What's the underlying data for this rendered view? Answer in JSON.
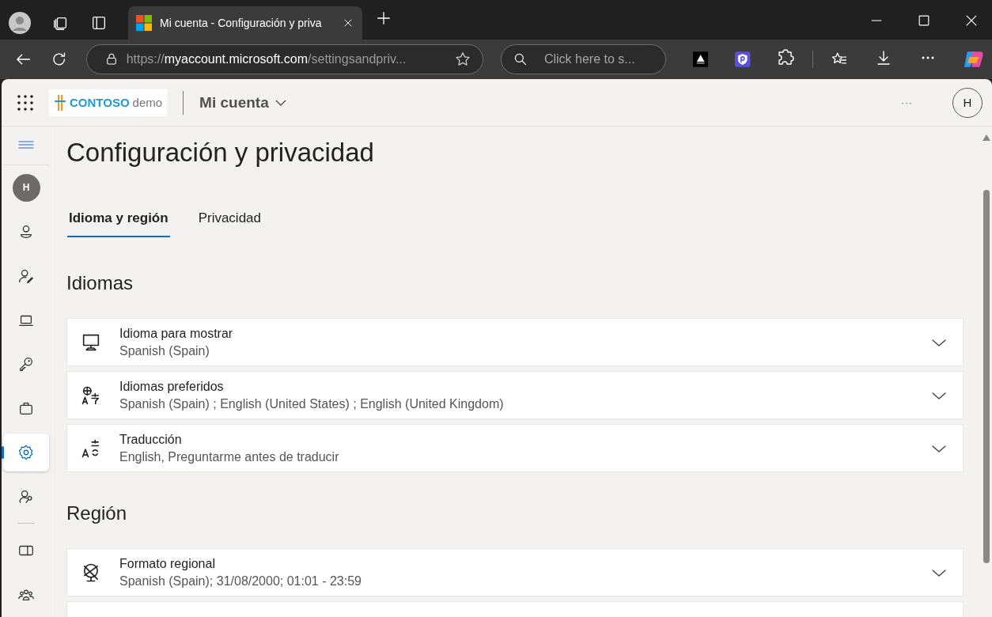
{
  "browser": {
    "tabs": [
      {
        "title": "Mi cuenta - Configuración y priva",
        "selected": true
      }
    ],
    "address": {
      "scheme": "https://",
      "host": "myaccount.microsoft.com",
      "path": "/settingsandpriv..."
    },
    "search": {
      "placeholder": "Click here to s..."
    }
  },
  "header": {
    "brand": "CONTOSO",
    "brand_suffix": "demo",
    "app_title": "Mi cuenta",
    "more": "···",
    "avatar": "H"
  },
  "sidebar": {
    "items": [
      {
        "kind": "menu"
      },
      {
        "kind": "avatar",
        "label": "H"
      },
      {
        "kind": "profile",
        "selected": false
      },
      {
        "kind": "info",
        "selected": false
      },
      {
        "kind": "devices",
        "selected": false
      },
      {
        "kind": "security",
        "selected": false
      },
      {
        "kind": "organizations",
        "selected": false
      },
      {
        "kind": "settings",
        "selected": true
      },
      {
        "kind": "privacy",
        "selected": false
      },
      {
        "kind": "divider"
      },
      {
        "kind": "subscriptions",
        "selected": false
      },
      {
        "kind": "groups",
        "selected": false
      }
    ]
  },
  "page": {
    "title": "Configuración y privacidad",
    "tabs": [
      {
        "label": "Idioma y región",
        "selected": true
      },
      {
        "label": "Privacidad",
        "selected": false
      }
    ],
    "sections": [
      {
        "heading": "Idiomas",
        "cards": [
          {
            "kind": "display",
            "title": "Idioma para mostrar",
            "value": "Spanish (Spain)"
          },
          {
            "kind": "preferred",
            "title": "Idiomas preferidos",
            "value": "Spanish (Spain) ; English (United States) ; English (United Kingdom)"
          },
          {
            "kind": "translation",
            "title": "Traducción",
            "value": "English, Preguntarme antes de traducir"
          }
        ]
      },
      {
        "heading": "Región",
        "cards": [
          {
            "kind": "regional",
            "title": "Formato regional",
            "value": "Spanish (Spain); 31/08/2000; 01:01 - 23:59"
          },
          {
            "kind": "cut"
          }
        ]
      }
    ]
  }
}
